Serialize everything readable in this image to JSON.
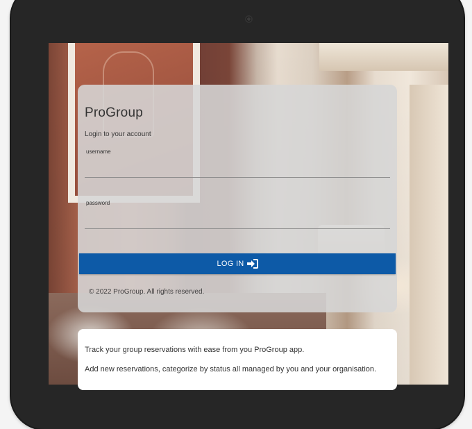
{
  "app": {
    "brand": "ProGroup",
    "subtitle": "Login to your account"
  },
  "form": {
    "username_label": "username",
    "username_value": "",
    "password_label": "password",
    "password_value": "",
    "login_label": "LOG IN"
  },
  "footer": {
    "copyright": "© 2022 ProGroup. All rights reserved."
  },
  "info": {
    "line1": "Track your group reservations with ease from you ProGroup app.",
    "line2": "Add new reservations, categorize by status all managed by you and your organisation."
  },
  "icons": {
    "login": "sign-in-icon",
    "camera": "camera-icon"
  },
  "colors": {
    "primary_button": "#0d5aa7",
    "device_bezel": "#262626"
  }
}
